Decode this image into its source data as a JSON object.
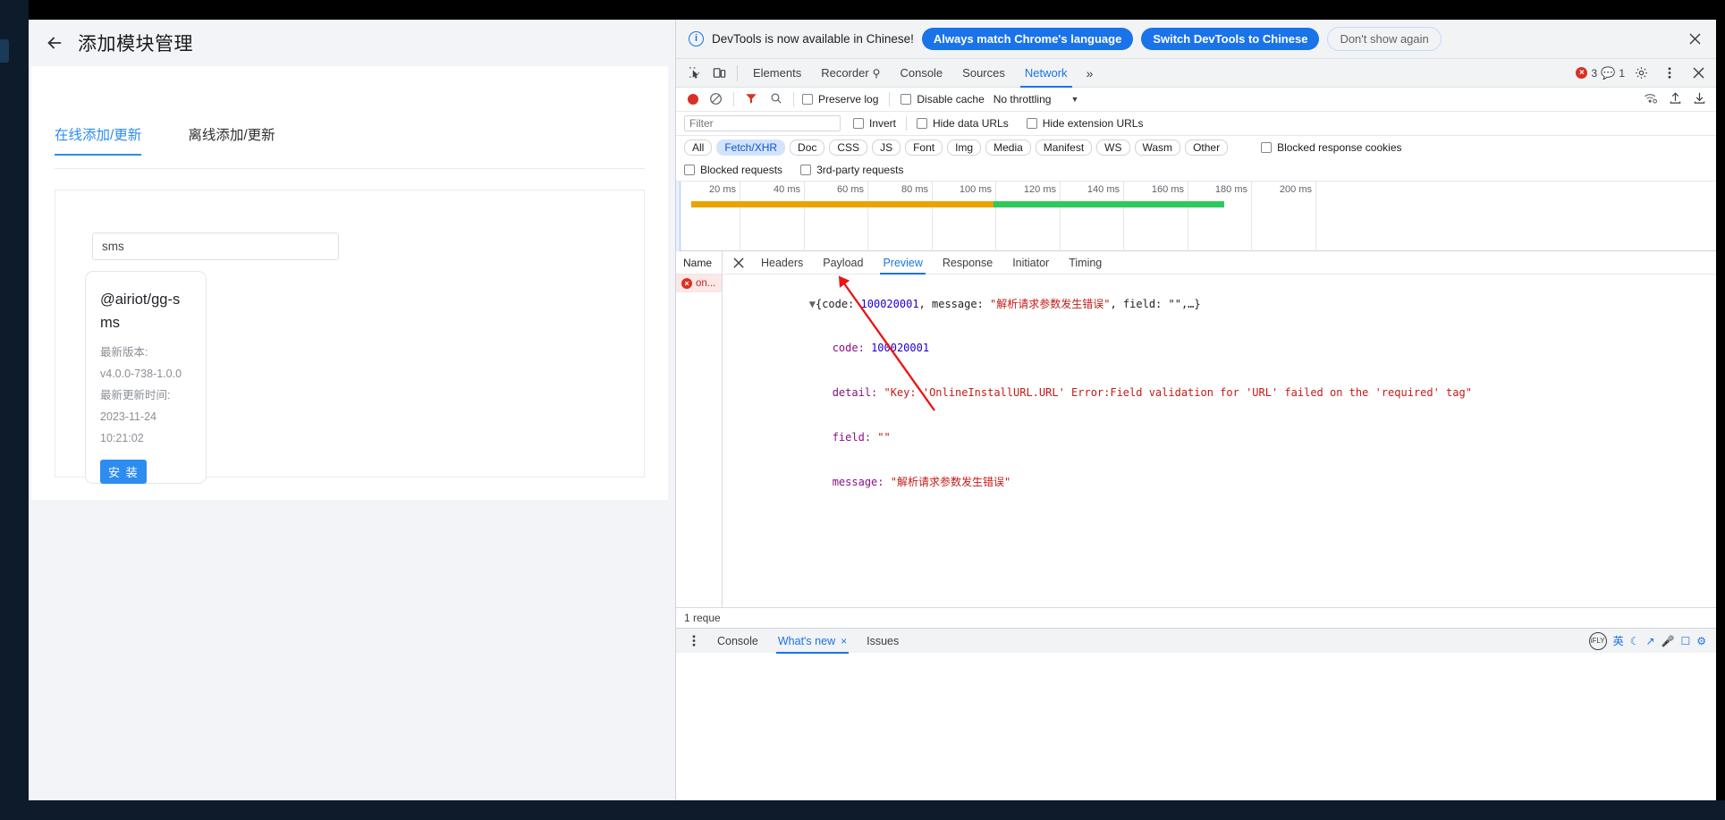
{
  "app": {
    "page_title": "添加模块管理",
    "back_icon": "arrow-left-icon",
    "tabs": [
      {
        "label": "在线添加/更新",
        "active": true
      },
      {
        "label": "离线添加/更新",
        "active": false
      }
    ],
    "search": {
      "value": "sms",
      "placeholder": ""
    },
    "module_card": {
      "name": "@airiot/gg-sms",
      "version_label": "最新版本:",
      "version_value": "v4.0.0-738-1.0.0",
      "updated_label": "最新更新时间:",
      "updated_date": "2023-11-24",
      "updated_time": "10:21:02",
      "install_label": "安 装"
    }
  },
  "devtools": {
    "notification": {
      "message": "DevTools is now available in Chinese!",
      "primary_button": "Always match Chrome's language",
      "secondary_button": "Switch DevTools to Chinese",
      "dismiss_button": "Don't show again",
      "close_icon": "close-icon",
      "info_icon": "info-icon"
    },
    "tabs": [
      {
        "label": "Elements",
        "active": false
      },
      {
        "label": "Recorder",
        "active": false,
        "suffix": "⚲"
      },
      {
        "label": "Console",
        "active": false
      },
      {
        "label": "Sources",
        "active": false
      },
      {
        "label": "Network",
        "active": true
      }
    ],
    "more_tabs_icon": "chevron-double-right-icon",
    "inspect_icon": "inspect-element-icon",
    "device_icon": "device-toolbar-icon",
    "error_count": "3",
    "warning_count": "1",
    "settings_icon": "gear-icon",
    "menu_icon": "kebab-menu-icon",
    "close_icon": "close-icon",
    "toolbar": {
      "record_icon": "record-stop-icon",
      "clear_icon": "clear-icon",
      "filter_icon": "filter-icon",
      "search_icon": "search-icon",
      "preserve_log": "Preserve log",
      "disable_cache": "Disable cache",
      "throttling": "No throttling",
      "throttle_caret": "▼",
      "wifi_icon": "network-conditions-icon",
      "import_icon": "import-har-icon",
      "export_icon": "export-har-icon",
      "settings_icon": "network-settings-gear-icon"
    },
    "filterbar": {
      "filter_placeholder": "Filter",
      "filter_value": "",
      "invert": "Invert",
      "hide_data_urls": "Hide data URLs",
      "hide_extension_urls": "Hide extension URLs",
      "blocked_response_cookies": "Blocked response cookies",
      "blocked_requests": "Blocked requests",
      "third_party_requests": "3rd-party requests"
    },
    "type_chips": [
      {
        "label": "All",
        "selected": false
      },
      {
        "label": "Fetch/XHR",
        "selected": true
      },
      {
        "label": "Doc",
        "selected": false
      },
      {
        "label": "CSS",
        "selected": false
      },
      {
        "label": "JS",
        "selected": false
      },
      {
        "label": "Font",
        "selected": false
      },
      {
        "label": "Img",
        "selected": false
      },
      {
        "label": "Media",
        "selected": false
      },
      {
        "label": "Manifest",
        "selected": false
      },
      {
        "label": "WS",
        "selected": false
      },
      {
        "label": "Wasm",
        "selected": false
      },
      {
        "label": "Other",
        "selected": false
      }
    ],
    "timeline": {
      "ticks": [
        "20 ms",
        "40 ms",
        "60 ms",
        "80 ms",
        "100 ms",
        "120 ms",
        "140 ms",
        "160 ms",
        "180 ms",
        "200 ms"
      ],
      "band_yellow_color": "#e8a400",
      "band_green_color": "#2ec95e"
    },
    "requests_header": "Name",
    "requests": [
      {
        "name": "on...",
        "status": "error"
      }
    ],
    "detail_tabs": [
      {
        "label": "Headers",
        "active": false
      },
      {
        "label": "Payload",
        "active": false
      },
      {
        "label": "Preview",
        "active": true
      },
      {
        "label": "Response",
        "active": false
      },
      {
        "label": "Initiator",
        "active": false
      },
      {
        "label": "Timing",
        "active": false
      }
    ],
    "detail_close_icon": "close-icon",
    "preview_json": {
      "summary_prefix": "{code: ",
      "summary_code": "100020001",
      "summary_mid": ", message: ",
      "summary_message": "\"解析请求参数发生错误\"",
      "summary_suffix": ", field: \"\",…}",
      "rows": [
        {
          "key": "code: ",
          "value": "100020001",
          "kind": "num"
        },
        {
          "key": "detail: ",
          "value": "\"Key: 'OnlineInstallURL.URL' Error:Field validation for 'URL' failed on the 'required' tag\"",
          "kind": "str"
        },
        {
          "key": "field: ",
          "value": "\"\"",
          "kind": "str"
        },
        {
          "key": "message: ",
          "value": "\"解析请求参数发生错误\"",
          "kind": "str"
        }
      ]
    },
    "status_text": "1 reque",
    "drawer": {
      "menu_icon": "kebab-menu-icon",
      "tabs": [
        {
          "label": "Console",
          "active": false
        },
        {
          "label": "What's new",
          "active": true,
          "closable": true
        },
        {
          "label": "Issues",
          "active": false
        }
      ],
      "close_icon": "close-icon",
      "ime_label": "iFLY",
      "ime_lang": "英",
      "ime_icons": [
        "moon-icon",
        "keyboard-icon",
        "mic-icon",
        "panel-icon",
        "gear-icon"
      ]
    }
  }
}
